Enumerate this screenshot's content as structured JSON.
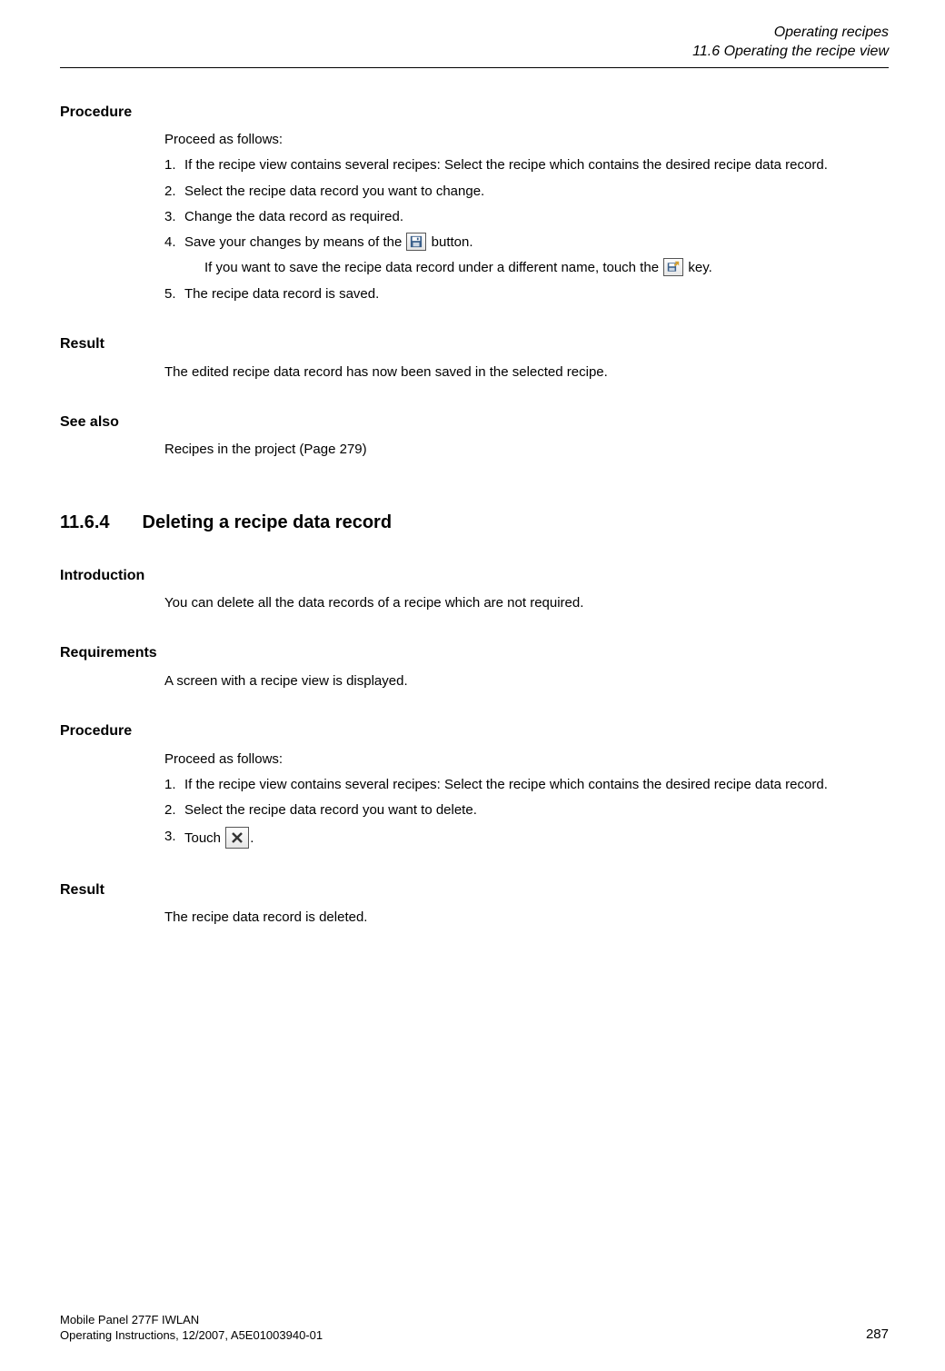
{
  "header": {
    "line1": "Operating recipes",
    "line2": "11.6 Operating the recipe view"
  },
  "s1": {
    "title": "Procedure",
    "intro": "Proceed as follows:",
    "items": {
      "n1": "1.",
      "t1": "If the recipe view contains several recipes: Select the recipe which contains the desired recipe data record.",
      "n2": "2.",
      "t2": "Select the recipe data record you want to change.",
      "n3": "3.",
      "t3": "Change the data record as required.",
      "n4": "4.",
      "t4a": "Save your changes by means of the ",
      "t4b": " button.",
      "t4sub_a": "If you want to save the recipe data record under a different name, touch the ",
      "t4sub_b": " key.",
      "n5": "5.",
      "t5": "The recipe data record is saved."
    }
  },
  "s2": {
    "title": "Result",
    "text": "The edited recipe data record has now been saved in the selected recipe."
  },
  "s3": {
    "title": "See also",
    "text": "Recipes in the project (Page 279)"
  },
  "chapter": {
    "num": "11.6.4",
    "title": "Deleting a recipe data record"
  },
  "s4": {
    "title": "Introduction",
    "text": "You can delete all the data records of a recipe which are not required."
  },
  "s5": {
    "title": "Requirements",
    "text": "A screen with a recipe view is displayed."
  },
  "s6": {
    "title": "Procedure",
    "intro": "Proceed as follows:",
    "items": {
      "n1": "1.",
      "t1": "If the recipe view contains several recipes: Select the recipe which contains the desired recipe data record.",
      "n2": "2.",
      "t2": "Select the recipe data record you want to delete.",
      "n3": "3.",
      "t3a": "Touch ",
      "t3b": "."
    }
  },
  "s7": {
    "title": "Result",
    "text": "The recipe data record is deleted."
  },
  "footer": {
    "l1": "Mobile Panel 277F IWLAN",
    "l2": "Operating Instructions, 12/2007, A5E01003940-01",
    "page": "287"
  },
  "icons": {
    "save": "save-icon",
    "saveas": "save-as-icon",
    "delete": "delete-icon"
  }
}
